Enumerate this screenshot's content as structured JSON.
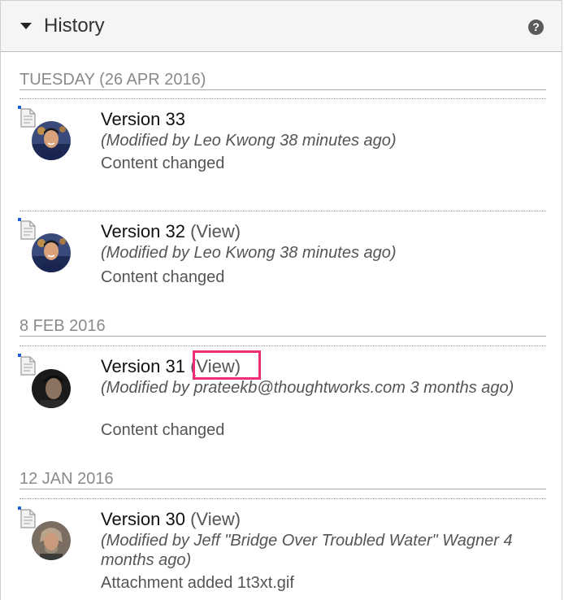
{
  "panel": {
    "title": "History",
    "help_symbol": "?"
  },
  "groups": [
    {
      "date": "TUESDAY (26 APR 2016)",
      "entries": [
        {
          "title": "Version 33",
          "view_label": "",
          "meta": "(Modified by Leo Kwong 38 minutes ago)",
          "change": "Content changed",
          "avatar": "leo-kwong"
        },
        {
          "title": "Version 32",
          "view_label": "(View)",
          "meta": "(Modified by Leo Kwong 38 minutes ago)",
          "change": "Content changed",
          "avatar": "leo-kwong"
        }
      ]
    },
    {
      "date": "8 FEB 2016",
      "entries": [
        {
          "title": "Version 31",
          "view_label": "(View)",
          "meta": "(Modified by prateekb@thoughtworks.com 3 months ago)",
          "change": "Content changed",
          "avatar": "prateekb"
        }
      ]
    },
    {
      "date": "12 JAN 2016",
      "entries": [
        {
          "title": "Version 30",
          "view_label": "(View)",
          "meta": "(Modified by Jeff \"Bridge Over Troubled Water\" Wagner 4 months ago)",
          "change": "Attachment added 1t3xt.gif",
          "avatar": "jeff-wagner"
        }
      ]
    }
  ],
  "colors": {
    "highlight": "#ec2f74",
    "date_header": "#8a8a8a",
    "doc_corner": "#1a5fd6"
  },
  "icons": {
    "caret": "caret-down-icon",
    "help": "help-icon",
    "document": "document-icon"
  }
}
